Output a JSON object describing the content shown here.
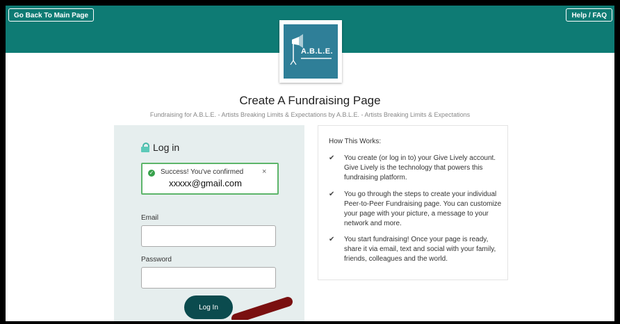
{
  "header": {
    "back_label": "Go Back To Main Page",
    "help_label": "Help / FAQ",
    "color": "#0e7b74"
  },
  "logo": {
    "text": "A.B.L.E.",
    "icon": "able-logo-icon"
  },
  "page": {
    "title": "Create A Fundraising Page",
    "subtitle": "Fundraising for A.B.L.E. - Artists Breaking Limits & Expectations by A.B.L.E. - Artists Breaking Limits & Expectations"
  },
  "login": {
    "heading": "Log in",
    "heading_icon": "lock-icon",
    "alert": {
      "message": "Success! You've confirmed",
      "email": "xxxxx@gmail.com",
      "close": "×",
      "icon": "check-circle-icon",
      "color": "#5db56a"
    },
    "email_label": "Email",
    "email_value": "",
    "password_label": "Password",
    "password_value": "",
    "button_label": "Log In",
    "button_color": "#0b4b4e"
  },
  "how": {
    "title": "How This Works:",
    "check_glyph": "✔",
    "items": [
      {
        "text": "You create (or log in to) your Give Lively account. Give Lively is the technology that powers this fundraising platform."
      },
      {
        "text": "You go through the steps to create your individual Peer-to-Peer Fundraising page. You can customize your page with your picture, a message to your network and more."
      },
      {
        "text": "You start fundraising! Once your page is ready, share it via email, text and social with your family, friends, colleagues and the world."
      }
    ]
  },
  "annotation": {
    "icon": "arrow-annotation-icon",
    "color": "#7a1010"
  }
}
